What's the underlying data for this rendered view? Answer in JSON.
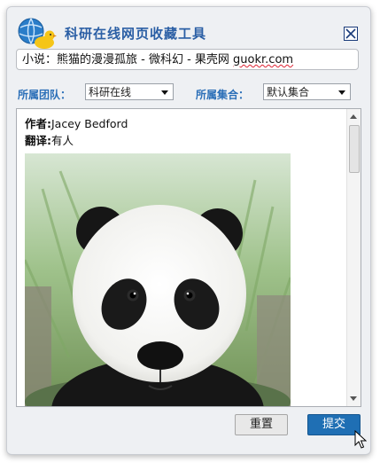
{
  "window": {
    "title": "科研在线网页收藏工具"
  },
  "url_field": {
    "value_prefix": "小说：熊猫的漫漫孤旅 - 微科幻 - 果壳网 ",
    "value_suffix": "guokr.com"
  },
  "team": {
    "label": "所属团队：",
    "selected": "科研在线"
  },
  "collection": {
    "label": "所属集合：",
    "selected": "默认集合"
  },
  "content": {
    "author_label": "作者:",
    "author_value": "Jacey Bedford",
    "translator_label": "翻译:",
    "translator_value": "有人"
  },
  "buttons": {
    "reset": "重置",
    "submit": "提交"
  },
  "colors": {
    "title": "#2b5fa5",
    "label": "#2b6fb8",
    "submit_bg": "#1f6fb4"
  }
}
